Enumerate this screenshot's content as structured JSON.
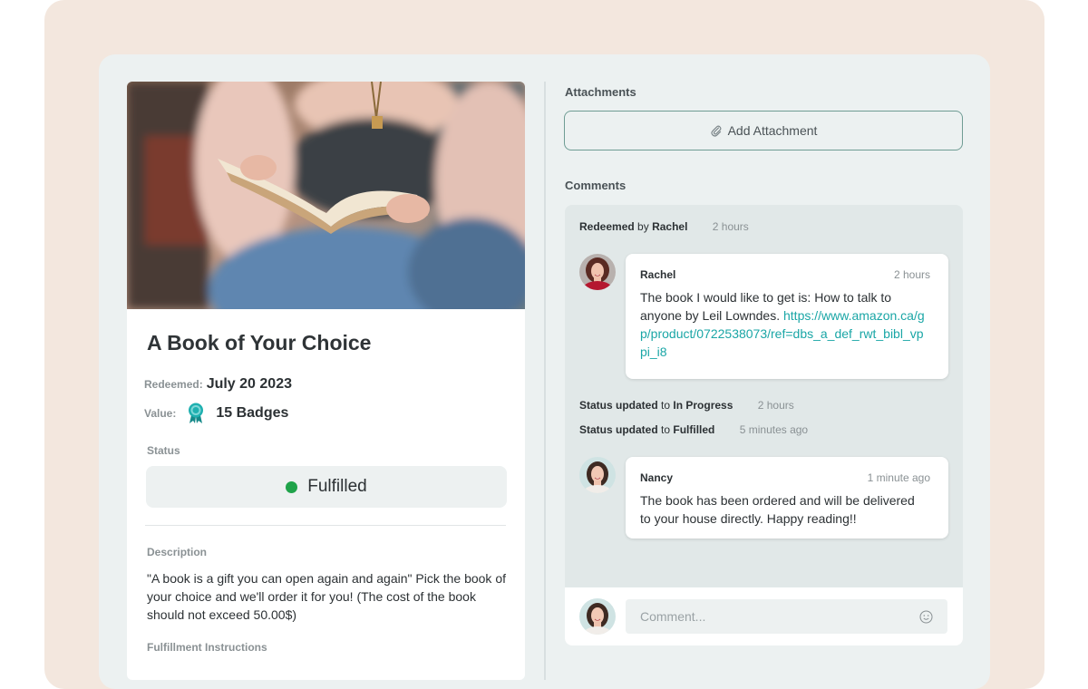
{
  "reward": {
    "title": "A Book of Your Choice",
    "redeemed_label": "Redeemed:",
    "redeemed_date": "July 20 2023",
    "value_label": "Value:",
    "value": "15 Badges",
    "status_label": "Status",
    "status": "Fulfilled",
    "status_color": "#1fa34a",
    "description_label": "Description",
    "description": "\"A book is a gift you can open again and again\" Pick the book of your choice and we'll order it for you! (The cost of the book should not exceed 50.00$)",
    "fulfillment_label": "Fulfillment Instructions"
  },
  "attachments": {
    "label": "Attachments",
    "add_button": "Add Attachment",
    "icon": "paperclip-icon"
  },
  "comments": {
    "label": "Comments",
    "events": [
      {
        "action": "Redeemed",
        "connector": "by",
        "target": "Rachel",
        "time": "2 hours"
      },
      {
        "action": "Status updated",
        "connector": "to",
        "target": "In Progress",
        "time": "2 hours"
      },
      {
        "action": "Status updated",
        "connector": "to",
        "target": "Fulfilled",
        "time": "5 minutes ago"
      }
    ],
    "messages": [
      {
        "author": "Rachel",
        "time": "2 hours",
        "text": "The book I would like to get is: How to talk to anyone by Leil Lowndes.",
        "link": "https://www.amazon.ca/gp/product/0722538073/ref=dbs_a_def_rwt_bibl_vppi_i8"
      },
      {
        "author": "Nancy",
        "time": "1 minute ago",
        "text": "The book has been ordered and will be delivered to your house directly. Happy reading!!"
      }
    ],
    "compose_placeholder": "Comment...",
    "accent_color": "#1aa6a6"
  }
}
